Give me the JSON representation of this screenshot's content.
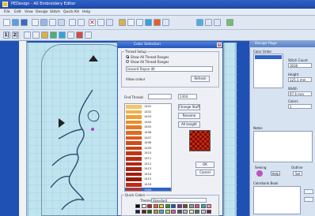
{
  "window": {
    "title": "PEDesign - All Embroidery Editor"
  },
  "menu": [
    "File",
    "Edit",
    "View",
    "Design",
    "Stitch",
    "Quick Kit",
    "Help"
  ],
  "toolbar": {
    "row1_icons": [
      "new-icon",
      "open-icon",
      "save-icon",
      "print-icon",
      "cut-icon",
      "copy-icon",
      "paste-icon",
      "undo-icon",
      "redo-icon",
      "delete-icon",
      "zoom-icon",
      "color-icon",
      "fill-icon",
      "pen-icon",
      "text-icon",
      "shape-icon",
      "grid-icon",
      "view-icon"
    ],
    "row2_icons": [
      "select-icon",
      "node-icon",
      "stitch-icon",
      "lock-icon",
      "color-wheel-icon",
      "thread-icon",
      "settings-icon"
    ]
  },
  "dialog": {
    "title": "Color Selection",
    "close": "✕",
    "group_label": "Thread Setup",
    "radio_all": "Show All Thread Ranges",
    "radio_sel": "Show All Thread Ranges",
    "brand_value": "Isacord Rayon 40",
    "all_label": "Allow colour",
    "refresh_btn": "Refresh",
    "find_label": "Find Thread:",
    "find_value": "",
    "find_code": "1304",
    "change_btn": "Change Stuff",
    "rename_btn": "Rename",
    "insight_btn": "All Insight",
    "ok_btn": "OK",
    "cancel_btn": "Cancel",
    "quick_label": "Quick Colors",
    "theme_label": "Theme:",
    "theme_value": "Standard",
    "threads": [
      {
        "code": "1401",
        "color": "#f3c56a"
      },
      {
        "code": "1402",
        "color": "#f0b24e"
      },
      {
        "code": "1403",
        "color": "#eea03a"
      },
      {
        "code": "1404",
        "color": "#ea8f2c"
      },
      {
        "code": "1405",
        "color": "#e57c25"
      },
      {
        "code": "1406",
        "color": "#e06a22"
      },
      {
        "code": "1407",
        "color": "#d95a1e"
      },
      {
        "code": "1408",
        "color": "#d24c1b"
      },
      {
        "code": "1409",
        "color": "#c94018"
      },
      {
        "code": "1410",
        "color": "#c13616"
      },
      {
        "code": "1411",
        "color": "#b82e14"
      },
      {
        "code": "1412",
        "color": "#b02812"
      },
      {
        "code": "1413",
        "color": "#a82210"
      },
      {
        "code": "1414",
        "color": "#a01e0e"
      },
      {
        "code": "1415",
        "color": "#981a0c"
      },
      {
        "code": "1416",
        "color": "#c42a12"
      },
      {
        "code": "1304",
        "color": "#c7301a"
      }
    ],
    "quick_colors_row1": [
      "#000000",
      "#ffffff",
      "#d01a1a",
      "#e86a1c",
      "#f2d21c",
      "#2a9a2a",
      "#1a58c8",
      "#8a2aa8",
      "#7a4a22",
      "#999999",
      "#e24c8a",
      "#2ab0c8",
      "#f0a0a0"
    ],
    "quick_colors_row2": [
      "#1a1a6a",
      "#6a1a1a",
      "#1a6a1a",
      "#c89a1a",
      "#5aa0e0",
      "#a0e05a",
      "#e05aa0",
      "#555555",
      "#bbbbbb",
      "#f5e6b0",
      "#3a7a5a",
      "#e0c0f0",
      "#8a1a3a"
    ]
  },
  "right_panel": {
    "title": "Design Page",
    "color_order": "Color Order",
    "stitch_count_label": "Stitch Count",
    "stitch_count": "3030",
    "height_label": "Height",
    "height_value": "125.1 mm",
    "width_label": "Width",
    "width_value": "97.6 mm",
    "colors_label": "Colors",
    "colors_value": "1",
    "notes_label": "Notes",
    "sewing_label": "Sewing",
    "outline_label": "Outline",
    "help_label": "Help",
    "sel_label": "Sel",
    "colorbank_label": "Colorbank Book"
  }
}
